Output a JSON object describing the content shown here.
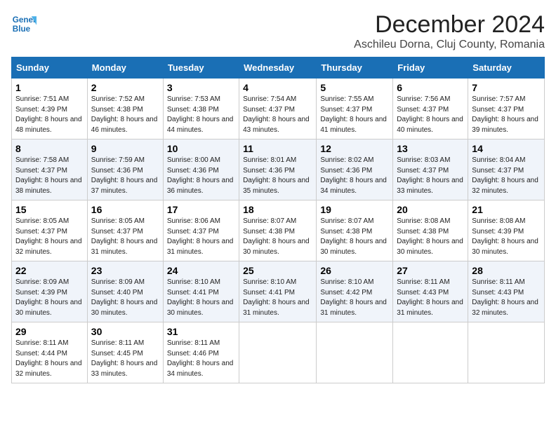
{
  "logo": {
    "line1": "General",
    "line2": "Blue"
  },
  "title": "December 2024",
  "location": "Aschileu Dorna, Cluj County, Romania",
  "weekdays": [
    "Sunday",
    "Monday",
    "Tuesday",
    "Wednesday",
    "Thursday",
    "Friday",
    "Saturday"
  ],
  "weeks": [
    [
      {
        "day": "1",
        "sunrise": "7:51 AM",
        "sunset": "4:39 PM",
        "daylight": "8 hours and 48 minutes."
      },
      {
        "day": "2",
        "sunrise": "7:52 AM",
        "sunset": "4:38 PM",
        "daylight": "8 hours and 46 minutes."
      },
      {
        "day": "3",
        "sunrise": "7:53 AM",
        "sunset": "4:38 PM",
        "daylight": "8 hours and 44 minutes."
      },
      {
        "day": "4",
        "sunrise": "7:54 AM",
        "sunset": "4:37 PM",
        "daylight": "8 hours and 43 minutes."
      },
      {
        "day": "5",
        "sunrise": "7:55 AM",
        "sunset": "4:37 PM",
        "daylight": "8 hours and 41 minutes."
      },
      {
        "day": "6",
        "sunrise": "7:56 AM",
        "sunset": "4:37 PM",
        "daylight": "8 hours and 40 minutes."
      },
      {
        "day": "7",
        "sunrise": "7:57 AM",
        "sunset": "4:37 PM",
        "daylight": "8 hours and 39 minutes."
      }
    ],
    [
      {
        "day": "8",
        "sunrise": "7:58 AM",
        "sunset": "4:37 PM",
        "daylight": "8 hours and 38 minutes."
      },
      {
        "day": "9",
        "sunrise": "7:59 AM",
        "sunset": "4:36 PM",
        "daylight": "8 hours and 37 minutes."
      },
      {
        "day": "10",
        "sunrise": "8:00 AM",
        "sunset": "4:36 PM",
        "daylight": "8 hours and 36 minutes."
      },
      {
        "day": "11",
        "sunrise": "8:01 AM",
        "sunset": "4:36 PM",
        "daylight": "8 hours and 35 minutes."
      },
      {
        "day": "12",
        "sunrise": "8:02 AM",
        "sunset": "4:36 PM",
        "daylight": "8 hours and 34 minutes."
      },
      {
        "day": "13",
        "sunrise": "8:03 AM",
        "sunset": "4:37 PM",
        "daylight": "8 hours and 33 minutes."
      },
      {
        "day": "14",
        "sunrise": "8:04 AM",
        "sunset": "4:37 PM",
        "daylight": "8 hours and 32 minutes."
      }
    ],
    [
      {
        "day": "15",
        "sunrise": "8:05 AM",
        "sunset": "4:37 PM",
        "daylight": "8 hours and 32 minutes."
      },
      {
        "day": "16",
        "sunrise": "8:05 AM",
        "sunset": "4:37 PM",
        "daylight": "8 hours and 31 minutes."
      },
      {
        "day": "17",
        "sunrise": "8:06 AM",
        "sunset": "4:37 PM",
        "daylight": "8 hours and 31 minutes."
      },
      {
        "day": "18",
        "sunrise": "8:07 AM",
        "sunset": "4:38 PM",
        "daylight": "8 hours and 30 minutes."
      },
      {
        "day": "19",
        "sunrise": "8:07 AM",
        "sunset": "4:38 PM",
        "daylight": "8 hours and 30 minutes."
      },
      {
        "day": "20",
        "sunrise": "8:08 AM",
        "sunset": "4:38 PM",
        "daylight": "8 hours and 30 minutes."
      },
      {
        "day": "21",
        "sunrise": "8:08 AM",
        "sunset": "4:39 PM",
        "daylight": "8 hours and 30 minutes."
      }
    ],
    [
      {
        "day": "22",
        "sunrise": "8:09 AM",
        "sunset": "4:39 PM",
        "daylight": "8 hours and 30 minutes."
      },
      {
        "day": "23",
        "sunrise": "8:09 AM",
        "sunset": "4:40 PM",
        "daylight": "8 hours and 30 minutes."
      },
      {
        "day": "24",
        "sunrise": "8:10 AM",
        "sunset": "4:41 PM",
        "daylight": "8 hours and 30 minutes."
      },
      {
        "day": "25",
        "sunrise": "8:10 AM",
        "sunset": "4:41 PM",
        "daylight": "8 hours and 31 minutes."
      },
      {
        "day": "26",
        "sunrise": "8:10 AM",
        "sunset": "4:42 PM",
        "daylight": "8 hours and 31 minutes."
      },
      {
        "day": "27",
        "sunrise": "8:11 AM",
        "sunset": "4:43 PM",
        "daylight": "8 hours and 31 minutes."
      },
      {
        "day": "28",
        "sunrise": "8:11 AM",
        "sunset": "4:43 PM",
        "daylight": "8 hours and 32 minutes."
      }
    ],
    [
      {
        "day": "29",
        "sunrise": "8:11 AM",
        "sunset": "4:44 PM",
        "daylight": "8 hours and 32 minutes."
      },
      {
        "day": "30",
        "sunrise": "8:11 AM",
        "sunset": "4:45 PM",
        "daylight": "8 hours and 33 minutes."
      },
      {
        "day": "31",
        "sunrise": "8:11 AM",
        "sunset": "4:46 PM",
        "daylight": "8 hours and 34 minutes."
      },
      null,
      null,
      null,
      null
    ]
  ]
}
